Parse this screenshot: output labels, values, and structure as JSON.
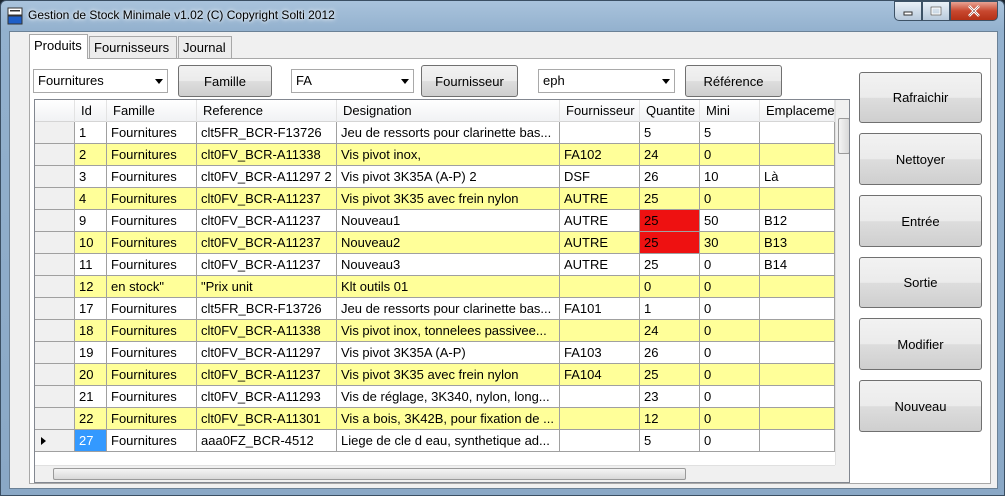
{
  "window": {
    "title": "Gestion de Stock Minimale v1.02 (C) Copyright Solti 2012"
  },
  "tabs": [
    {
      "label": "Produits"
    },
    {
      "label": "Fournisseurs"
    },
    {
      "label": "Journal"
    }
  ],
  "filters": {
    "famille": {
      "value": "Fournitures",
      "button": "Famille"
    },
    "fournisseur": {
      "value": "FA",
      "button": "Fournisseur"
    },
    "reference": {
      "value": "eph",
      "button": "Référence"
    }
  },
  "actions": {
    "rafraichir": "Rafraichir",
    "nettoyer": "Nettoyer",
    "entree": "Entrée",
    "sortie": "Sortie",
    "modifier": "Modifier",
    "nouveau": "Nouveau"
  },
  "grid": {
    "columns": [
      "Id",
      "Famille",
      "Reference",
      "Designation",
      "Fournisseur",
      "Quantite",
      "Mini",
      "Emplacement"
    ],
    "rows": [
      [
        "1",
        "Fournitures",
        "clt5FR_BCR-F13726",
        "Jeu de ressorts pour clarinette bas...",
        "",
        "5",
        "5",
        ""
      ],
      [
        "2",
        "Fournitures",
        "clt0FV_BCR-A11338",
        "Vis pivot inox,",
        "FA102",
        "24",
        "0",
        ""
      ],
      [
        "3",
        "Fournitures",
        "clt0FV_BCR-A11297 2",
        "Vis pivot 3K35A (A-P) 2",
        "DSF",
        "26",
        "10",
        "Là"
      ],
      [
        "4",
        "Fournitures",
        "clt0FV_BCR-A11237",
        "Vis pivot 3K35 avec frein nylon",
        "AUTRE",
        "25",
        "0",
        ""
      ],
      [
        "9",
        "Fournitures",
        "clt0FV_BCR-A11237",
        "Nouveau1",
        "AUTRE",
        "25",
        "50",
        "B12"
      ],
      [
        "10",
        "Fournitures",
        "clt0FV_BCR-A11237",
        "Nouveau2",
        "AUTRE",
        "25",
        "30",
        "B13"
      ],
      [
        "11",
        "Fournitures",
        "clt0FV_BCR-A11237",
        "Nouveau3",
        "AUTRE",
        "25",
        "0",
        "B14"
      ],
      [
        "12",
        "en stock\"",
        "\"Prix unit",
        "Klt outils 01",
        "",
        "0",
        "0",
        ""
      ],
      [
        "17",
        "Fournitures",
        "clt5FR_BCR-F13726",
        "Jeu de ressorts pour clarinette bas...",
        "FA101",
        "1",
        "0",
        ""
      ],
      [
        "18",
        "Fournitures",
        "clt0FV_BCR-A11338",
        "Vis pivot inox, tonnelees passivee...",
        "",
        "24",
        "0",
        ""
      ],
      [
        "19",
        "Fournitures",
        "clt0FV_BCR-A11297",
        "Vis pivot 3K35A (A-P)",
        "FA103",
        "26",
        "0",
        ""
      ],
      [
        "20",
        "Fournitures",
        "clt0FV_BCR-A11237",
        "Vis pivot 3K35 avec frein nylon",
        "FA104",
        "25",
        "0",
        ""
      ],
      [
        "21",
        "Fournitures",
        "clt0FV_BCR-A11293",
        "Vis de réglage, 3K340, nylon, long...",
        "",
        "23",
        "0",
        ""
      ],
      [
        "22",
        "Fournitures",
        "clt0FV_BCR-A11301",
        "Vis a bois, 3K42B, pour fixation de ...",
        "",
        "12",
        "0",
        ""
      ],
      [
        "27",
        "Fournitures",
        "aaa0FZ_BCR-4512",
        "Liege de cle d eau, synthetique ad...",
        "",
        "5",
        "0",
        ""
      ]
    ],
    "alert_rows": [
      4,
      5
    ],
    "current_row": 14,
    "colors": {
      "alt_row": "#ffff99",
      "alert": "#ee1111",
      "selected": "#3399ff"
    }
  },
  "icons": [
    "app-icon",
    "minimize-icon",
    "maximize-icon",
    "close-icon",
    "row-pointer-icon",
    "scroll-up-icon",
    "scroll-down-icon",
    "scroll-left-icon",
    "scroll-right-icon"
  ]
}
